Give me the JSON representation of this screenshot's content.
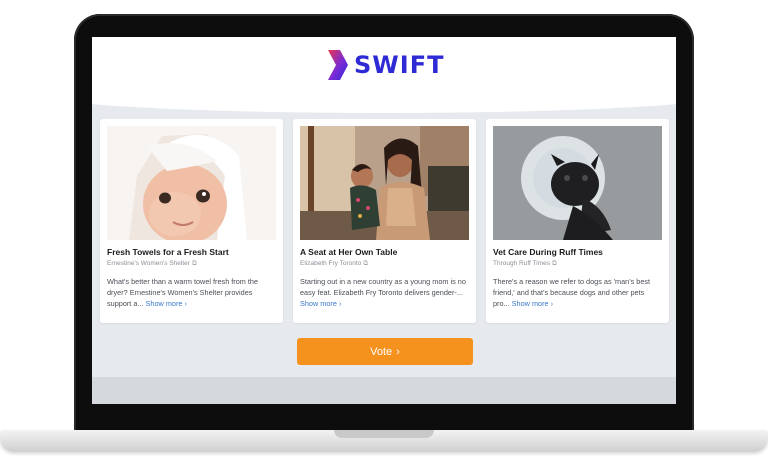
{
  "brand": {
    "name": "SWIFT",
    "color": "#2e2ad4",
    "mark_colors": [
      "#e8374f",
      "#7a2bd6",
      "#2e2ad4"
    ]
  },
  "cards": [
    {
      "title": "Fresh Towels for a Fresh Start",
      "source": "Ernestine's Women's Shelter",
      "description": "What's better than a warm towel fresh from the dryer? Ernestine's Women's Shelter provides support a...",
      "show_more": "Show more",
      "image": "baby-in-towel-photo"
    },
    {
      "title": "A Seat at Her Own Table",
      "source": "Elizabeth Fry Toronto",
      "description": "Starting out in a new country as a young mom is no easy feat. Elizabeth Fry Toronto delivers gender-...",
      "show_more": "Show more",
      "image": "mother-and-child-photo"
    },
    {
      "title": "Vet Care During Ruff Times",
      "source": "Through Ruff Times",
      "description": "There's a reason we refer to dogs as 'man's best friend,' and that's because dogs and other pets pro...",
      "show_more": "Show more",
      "image": "pug-with-cone-photo"
    }
  ],
  "vote": {
    "label": "Vote",
    "color": "#f5921e"
  }
}
